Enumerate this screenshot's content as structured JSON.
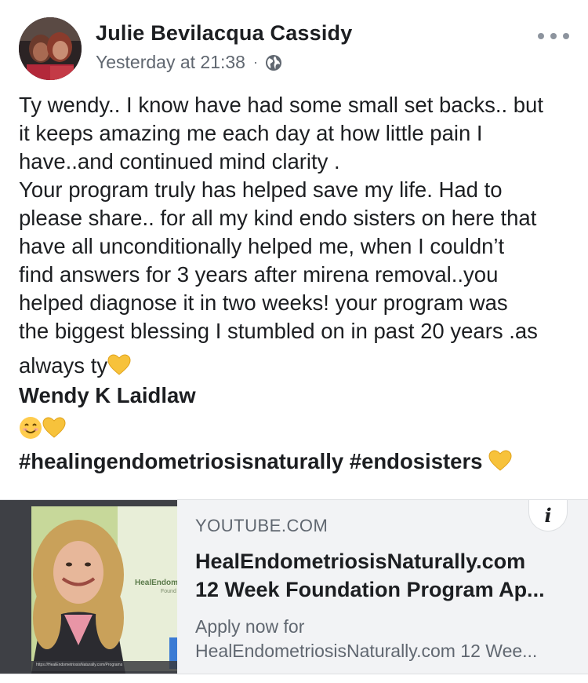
{
  "post": {
    "author": "Julie Bevilacqua Cassidy",
    "timestamp": "Yesterday at 21:38",
    "separator": "·",
    "privacy_icon": "globe-icon",
    "more_icon": "more-options-icon",
    "body_lines": [
      "Ty wendy.. I know have had some small set backs.. but",
      "it keeps amazing me each day at how little pain I",
      "have..and continued mind clarity .",
      "Your program truly has helped save my life.  Had to",
      "please share.. for all my kind endo sisters on here that",
      "have all unconditionally helped me, when I couldn’t",
      "find answers for 3 years after mirena removal..you",
      "helped diagnose it in two weeks! your program was",
      "the biggest blessing I stumbled on in past 20 years .as",
      "always ty"
    ],
    "tagged_name": "Wendy K Laidlaw",
    "emojis": [
      "smiling-face-emoji",
      "yellow-heart-emoji"
    ],
    "hashtags": [
      "#healingendometriosisnaturally",
      "#endosisters"
    ]
  },
  "link_card": {
    "domain": "YOUTUBE.COM",
    "title_lines": [
      "HealEndometriosisNaturally.com",
      "12 Week Foundation Program Ap..."
    ],
    "description_lines": [
      "Apply now for",
      "HealEndometriosisNaturally.com 12 Wee..."
    ],
    "info_icon": "info-icon",
    "info_label": "i",
    "thumbnail": {
      "logo_text": "HealEndom",
      "logo_sub": "Found",
      "caption": "https://HealEndometriosisNaturally.com/Programs"
    }
  },
  "colors": {
    "text": "#1c1e21",
    "secondary": "#606770",
    "card_bg": "#f2f3f5",
    "heart": "#f7c23b"
  }
}
